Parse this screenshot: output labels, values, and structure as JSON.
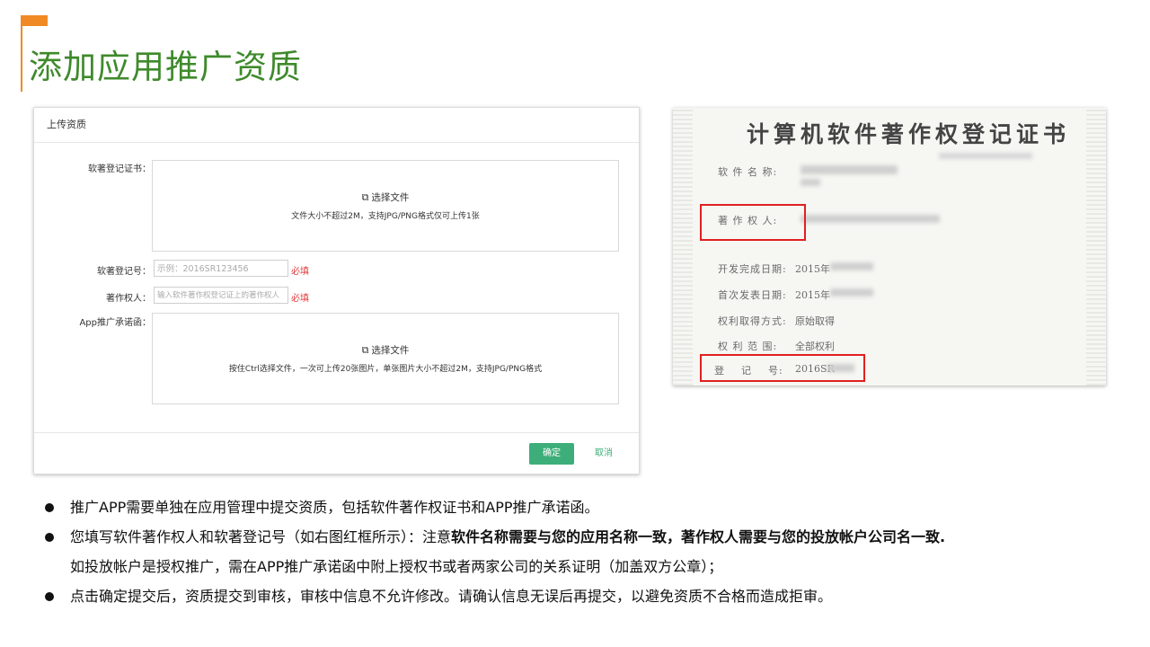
{
  "page": {
    "title": "添加应用推广资质",
    "accent_color": "#f08a24",
    "title_color": "#3f8a2c"
  },
  "dialog": {
    "header": "上传资质",
    "fields": {
      "cert_label": "软著登记证书：",
      "choose_file_label": "选择文件",
      "cert_hint": "文件大小不超过2M，支持JPG/PNG格式仅可上传1张",
      "reg_no_label": "软著登记号：",
      "reg_no_placeholder": "示例：2016SR123456",
      "required_text": "必填",
      "owner_label": "著作权人：",
      "owner_placeholder": "输入软件著作权登记证上的著作权人",
      "promise_label": "App推广承诺函：",
      "promise_hint": "按住Ctrl选择文件，一次可上传20张图片，单张图片大小不超过2M，支持JPG/PNG格式"
    },
    "buttons": {
      "ok": "确定",
      "cancel": "取消"
    },
    "button_color": "#3dae79"
  },
  "certificate": {
    "title": "计算机软件著作权登记证书",
    "rows": {
      "name_label": "软 件 名 称:",
      "owner_label": "著 作 权 人:",
      "finish_label": "开发完成日期:",
      "finish_value": "2015年",
      "publish_label": "首次发表日期:",
      "publish_value": "2015年",
      "acquire_label": "权利取得方式:",
      "acquire_value": "原始取得",
      "scope_label": "权 利 范 围:",
      "scope_value": "全部权利",
      "regno_label": "登    记    号:",
      "regno_value": "2016SR"
    },
    "highlight_color": "#e02020"
  },
  "bullets": [
    {
      "text": "推广APP需要单独在应用管理中提交资质，包括软件著作权证书和APP推广承诺函。"
    },
    {
      "text_before": "您填写软件著作权人和软著登记号（如右图红框所示）：注意",
      "text_bold": "软件名称需要与您的应用名称一致，著作权人需要与您的投放帐户公司名一致.",
      "text_after": "如投放帐户是授权推广，需在APP推广承诺函中附上授权书或者两家公司的关系证明（加盖双方公章）；"
    },
    {
      "text": "点击确定提交后，资质提交到审核，审核中信息不允许修改。请确认信息无误后再提交，以避免资质不合格而造成拒审。"
    }
  ]
}
